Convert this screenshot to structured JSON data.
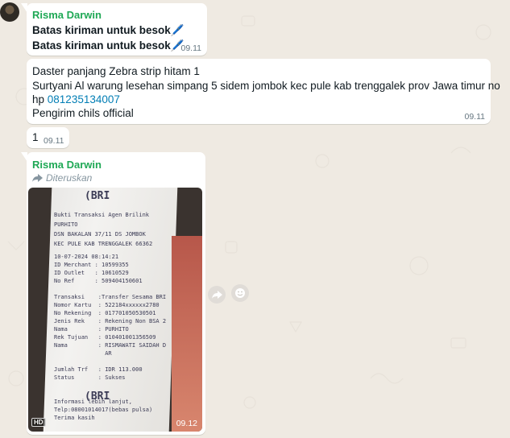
{
  "messages": [
    {
      "sender": "Risma Darwin",
      "lines": [
        "Batas kiriman untuk besok🖊️",
        "Batas kiriman untuk besok🖊️"
      ],
      "time": "09.11"
    },
    {
      "line1": "Daster panjang Zebra strip hitam 1",
      "line2": "Surtyani Al warung lesehan simpang 5 sidem jombok kec pule kab trenggalek prov Jawa timur no",
      "line3_prefix": "hp ",
      "phone": "081235134007",
      "line4": "Pengirim chils official",
      "time": "09.11"
    },
    {
      "text": "1",
      "time": "09.11"
    },
    {
      "sender": "Risma Darwin",
      "forwarded_label": "Diteruskan",
      "hd_badge": "HD",
      "time": "09.12",
      "receipt_lines": [
        "(BRI",
        "Bukti Transaksi Agen Brilink",
        "PURHITO",
        "DSN BAKALAN 37/11 DS JOMBOK",
        "KEC PULE KAB TRENGGALEK 66362",
        "10-07-2024 08:14:21",
        "ID Merchant : 10599355",
        "ID Outlet   : 10610529",
        "No Ref      : 509404150601",
        "Transaksi    :Transfer Sesama BRI",
        "Nomor Kartu  : 522184xxxxxx2780",
        "No Rekening  : 017701050530501",
        "Jenis Rek    : Rekening Non BSA 2",
        "Nama         : PURHITO",
        "Rek Tujuan   : 010401001356509",
        "Nama         : RISMAWATI SAIDAH D",
        "               AR",
        "Jumlah Trf   : IDR 113.000",
        "Status       : Sukses",
        "(BRI",
        "Informasi lebih lanjut,",
        "Telp:08001014017(bebas pulsa)",
        "Terima kasih"
      ]
    }
  ]
}
